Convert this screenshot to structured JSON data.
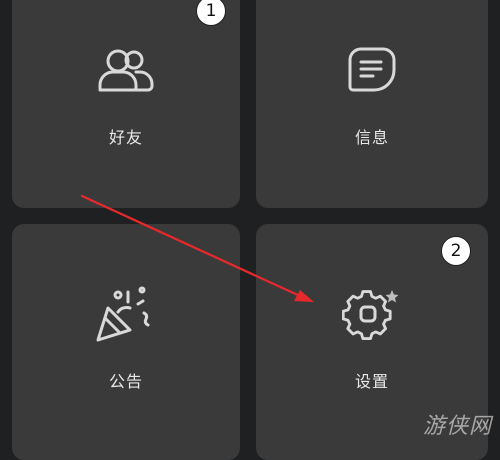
{
  "tiles": {
    "friends": {
      "label": "好友",
      "icon": "friends-icon",
      "step": "1"
    },
    "messages": {
      "label": "信息",
      "icon": "message-icon"
    },
    "notice": {
      "label": "公告",
      "icon": "party-popper-icon"
    },
    "settings": {
      "label": "设置",
      "icon": "gear-icon",
      "step": "2"
    }
  },
  "colors": {
    "background": "#1f2021",
    "tile": "#3a3a3b",
    "icon_stroke": "#d9d9d9",
    "arrow": "#e8292b"
  },
  "watermark": {
    "text": "游侠网"
  }
}
